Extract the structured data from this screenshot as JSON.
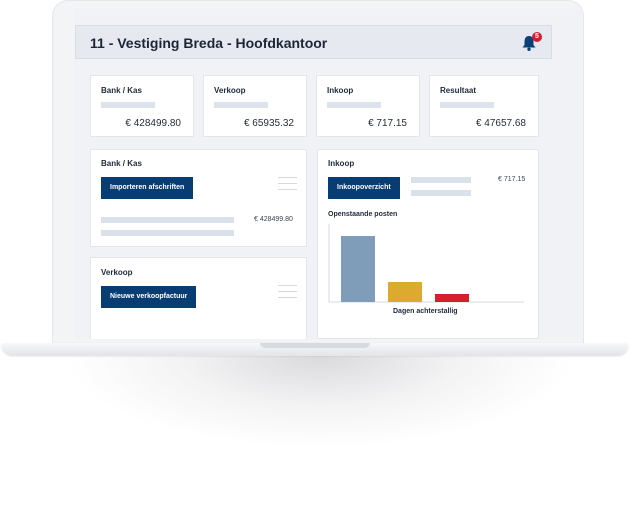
{
  "header": {
    "title": "11 - Vestiging Breda - Hoofdkantoor",
    "notification_count": "5"
  },
  "stats": [
    {
      "label": "Bank / Kas",
      "amount": "€ 428499.80"
    },
    {
      "label": "Verkoop",
      "amount": "€ 65935.32"
    },
    {
      "label": "Inkoop",
      "amount": "€ 717.15"
    },
    {
      "label": "Resultaat",
      "amount": "€ 47657.68"
    }
  ],
  "bank_card": {
    "title": "Bank / Kas",
    "button_label": "Importeren afschriften",
    "amount": "€ 428499.80"
  },
  "verkoop_card": {
    "title": "Verkoop",
    "button_label": "Nieuwe verkoopfactuur"
  },
  "inkoop_card": {
    "title": "Inkoop",
    "button_label": "Inkoopoverzicht",
    "amount": "€ 717.15",
    "chart_title": "Openstaande posten",
    "chart_xlabel": "Dagen achterstallig"
  },
  "chart_data": {
    "type": "bar",
    "title": "Openstaande posten",
    "xlabel": "Dagen achterstallig",
    "ylabel": "",
    "categories": [
      "",
      "",
      ""
    ],
    "values": [
      100,
      30,
      12
    ],
    "colors": [
      "#7f9db9",
      "#dcaa2e",
      "#d4202c"
    ],
    "ylim": [
      0,
      100
    ]
  },
  "colors": {
    "primary_button": "#083d73",
    "badge": "#d0202e",
    "placeholder": "#dbe1ea"
  },
  "icons": {
    "bell": "bell-icon",
    "menu": "hamburger-icon"
  }
}
